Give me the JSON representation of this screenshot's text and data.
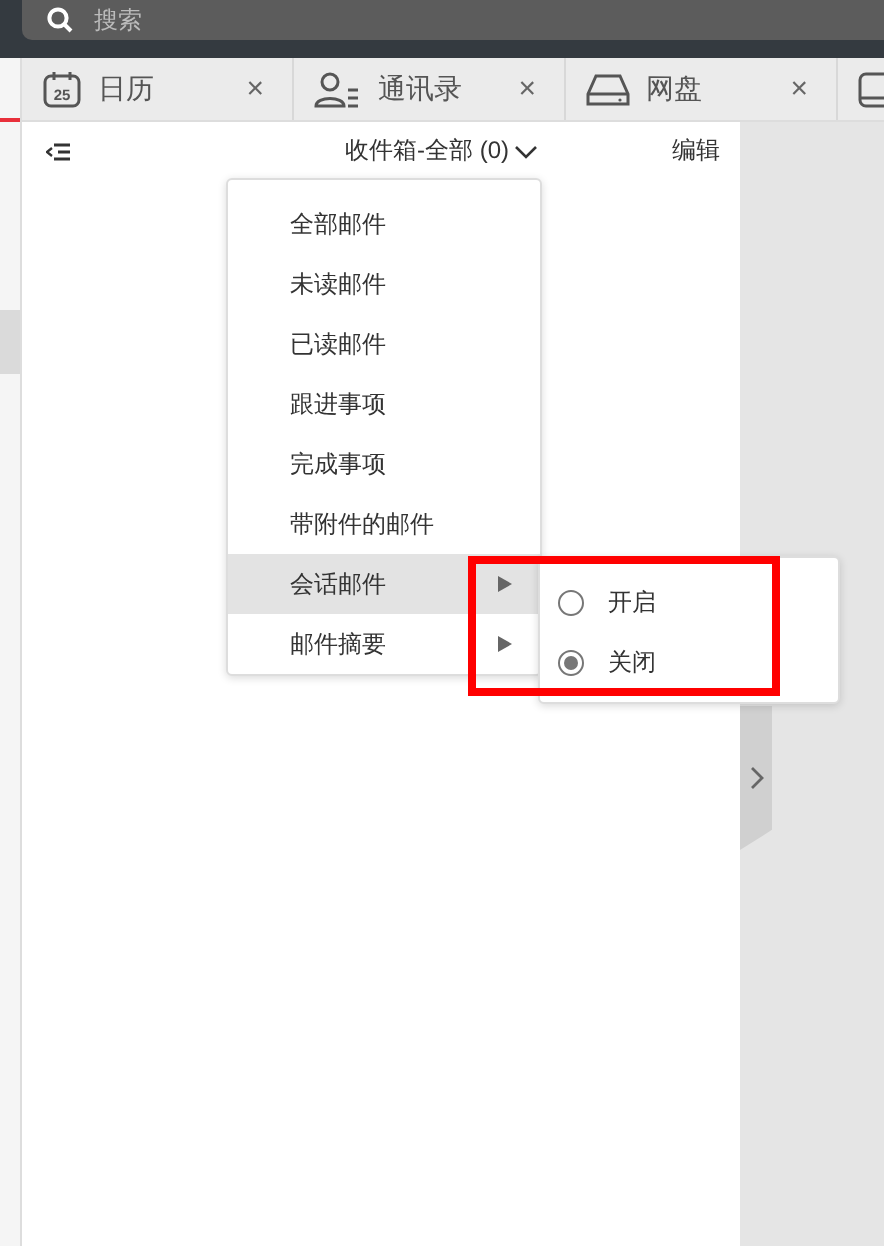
{
  "search": {
    "placeholder": "搜索"
  },
  "tabs": [
    {
      "label": "日历",
      "kind": "calendar",
      "day": "25",
      "close": "×",
      "selected": false
    },
    {
      "label": "通讯录",
      "kind": "contacts",
      "close": "×",
      "selected": false
    },
    {
      "label": "网盘",
      "kind": "drive",
      "close": "×",
      "selected": false
    },
    {
      "kind": "monitor",
      "selected": false
    }
  ],
  "header": {
    "title": "收件箱-全部 (0)",
    "action": "编辑"
  },
  "menu": [
    {
      "label": "全部邮件",
      "selected": false,
      "submenu": false
    },
    {
      "label": "未读邮件",
      "selected": false,
      "submenu": false
    },
    {
      "label": "已读邮件",
      "selected": false,
      "submenu": false
    },
    {
      "label": "跟进事项",
      "selected": false,
      "submenu": false
    },
    {
      "label": "完成事项",
      "selected": false,
      "submenu": false
    },
    {
      "label": "带附件的邮件",
      "selected": false,
      "submenu": false
    },
    {
      "label": "会话邮件",
      "selected": true,
      "submenu": true
    },
    {
      "label": "邮件摘要",
      "selected": false,
      "submenu": true
    }
  ],
  "submenu": [
    {
      "label": "开启",
      "selected": false
    },
    {
      "label": "关闭",
      "selected": true
    }
  ]
}
